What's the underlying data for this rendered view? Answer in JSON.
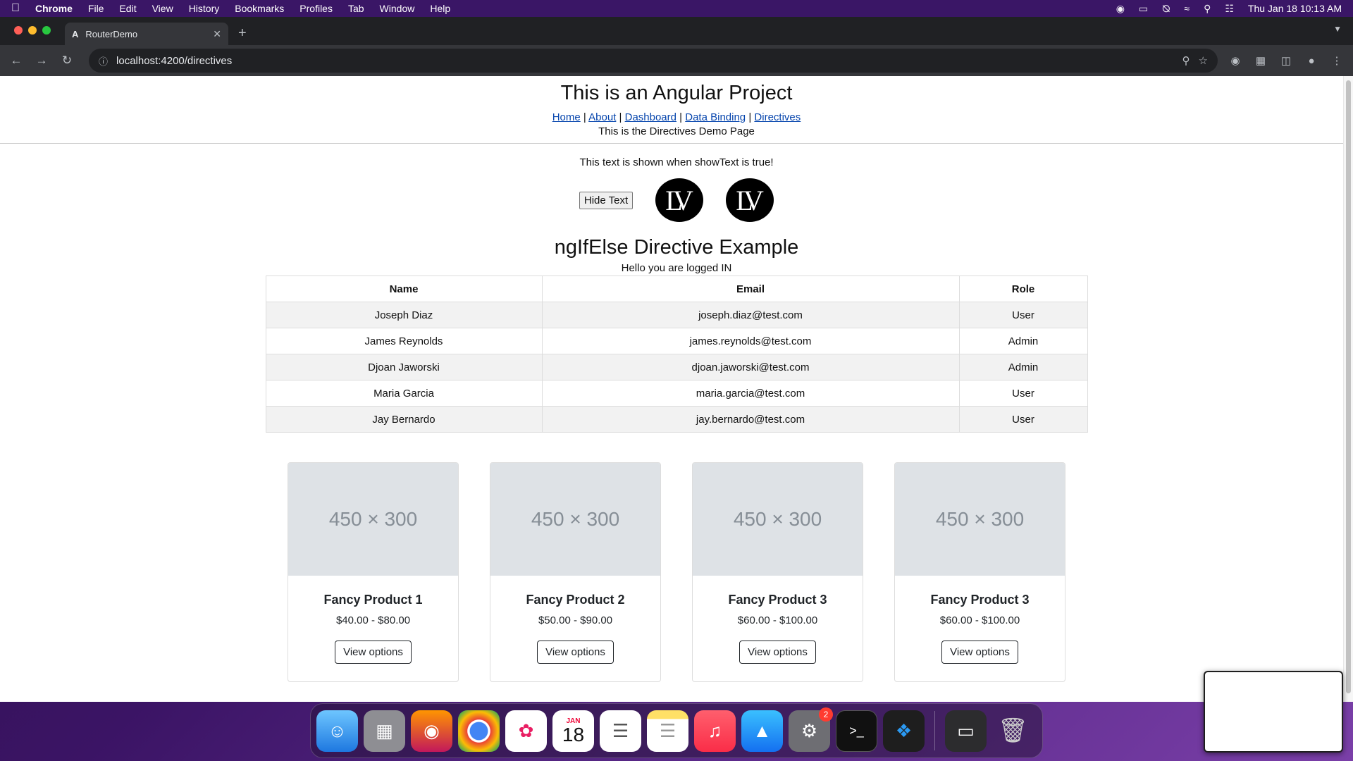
{
  "menubar": {
    "app": "Chrome",
    "items": [
      "File",
      "Edit",
      "View",
      "History",
      "Bookmarks",
      "Profiles",
      "Tab",
      "Window",
      "Help"
    ],
    "clock": "Thu Jan 18  10:13 AM"
  },
  "browser": {
    "tab_title": "RouterDemo",
    "tab_favicon": "A",
    "url": "localhost:4200/directives"
  },
  "page": {
    "title": "This is an Angular Project",
    "nav": [
      {
        "label": "Home"
      },
      {
        "label": "About"
      },
      {
        "label": "Dashboard"
      },
      {
        "label": "Data Binding"
      },
      {
        "label": "Directives"
      }
    ],
    "nav_separator": "|",
    "subtitle": "This is the Directives Demo Page",
    "show_text": "This text is shown when showText is true!",
    "hide_button": "Hide Text",
    "logo_text": "LV",
    "ngif_title": "ngIfElse Directive Example",
    "logged_message": "Hello you are logged IN",
    "table": {
      "headers": [
        "Name",
        "Email",
        "Role"
      ],
      "rows": [
        [
          "Joseph Diaz",
          "joseph.diaz@test.com",
          "User"
        ],
        [
          "James Reynolds",
          "james.reynolds@test.com",
          "Admin"
        ],
        [
          "Djoan Jaworski",
          "djoan.jaworski@test.com",
          "Admin"
        ],
        [
          "Maria Garcia",
          "maria.garcia@test.com",
          "User"
        ],
        [
          "Jay Bernardo",
          "jay.bernardo@test.com",
          "User"
        ]
      ]
    },
    "products": [
      {
        "placeholder": "450 × 300",
        "name": "Fancy Product 1",
        "price": "$40.00 - $80.00",
        "button": "View options"
      },
      {
        "placeholder": "450 × 300",
        "name": "Fancy Product 2",
        "price": "$50.00 - $90.00",
        "button": "View options"
      },
      {
        "placeholder": "450 × 300",
        "name": "Fancy Product 3",
        "price": "$60.00 - $100.00",
        "button": "View options"
      },
      {
        "placeholder": "450 × 300",
        "name": "Fancy Product 3",
        "price": "$60.00 - $100.00",
        "button": "View options"
      }
    ]
  },
  "dock": {
    "calendar_month": "JAN",
    "calendar_day": "18",
    "settings_badge": "2"
  }
}
